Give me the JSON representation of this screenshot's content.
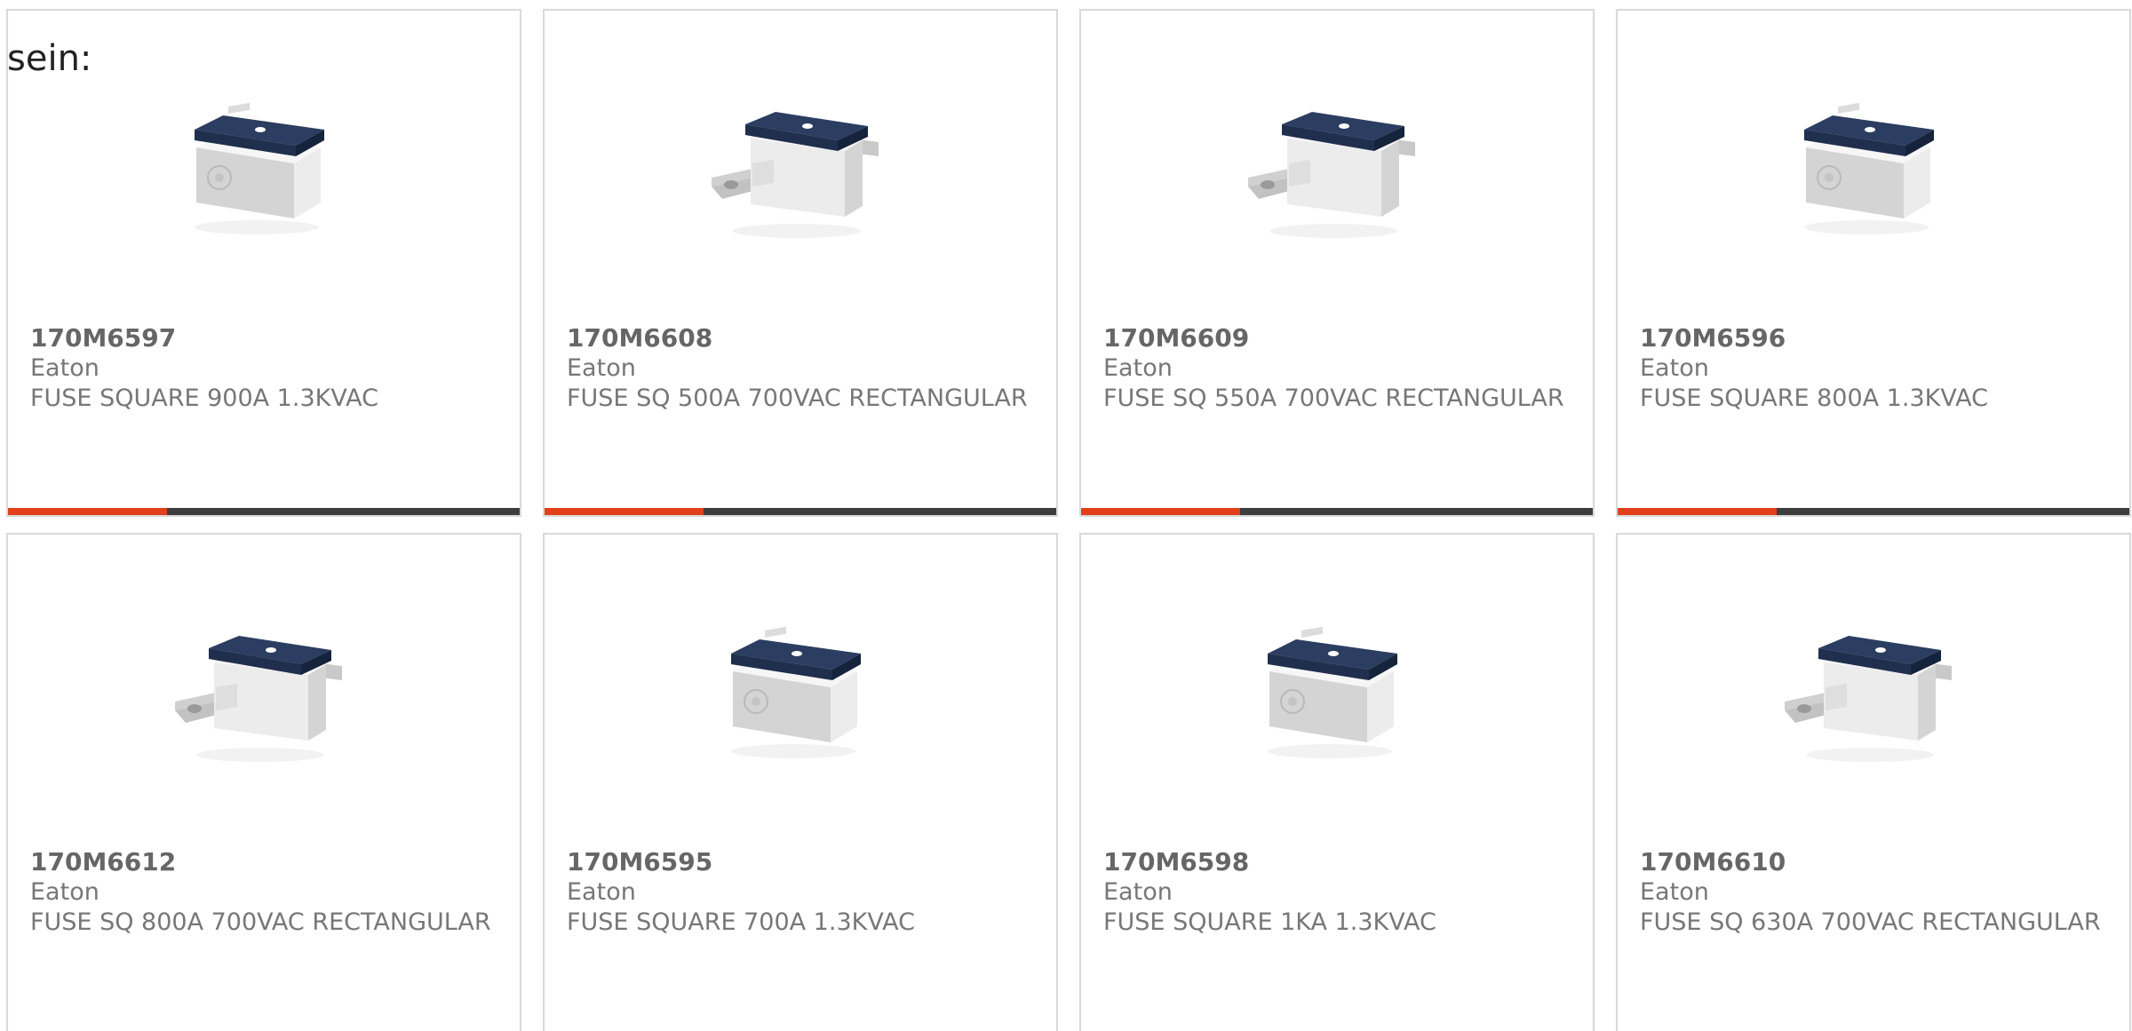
{
  "intro_text": "sein:",
  "colors": {
    "bar_track": "#3d3d3d",
    "bar_fill": "#e1401a",
    "card_border": "#d9d9d9"
  },
  "products": [
    {
      "mpn": "170M6597",
      "manufacturer": "Eaton",
      "description": "FUSE SQUARE 900A 1.3KVAC",
      "image": "fuse-square-body-image",
      "bar_fill_fraction": 0.31
    },
    {
      "mpn": "170M6608",
      "manufacturer": "Eaton",
      "description": "FUSE SQ 500A 700VAC RECTANGULAR",
      "image": "fuse-with-tabs-image",
      "bar_fill_fraction": 0.31
    },
    {
      "mpn": "170M6609",
      "manufacturer": "Eaton",
      "description": "FUSE SQ 550A 700VAC RECTANGULAR",
      "image": "fuse-with-tabs-image",
      "bar_fill_fraction": 0.31
    },
    {
      "mpn": "170M6596",
      "manufacturer": "Eaton",
      "description": "FUSE SQUARE 800A 1.3KVAC",
      "image": "fuse-square-body-image",
      "bar_fill_fraction": 0.31
    },
    {
      "mpn": "170M6612",
      "manufacturer": "Eaton",
      "description": "FUSE SQ 800A 700VAC RECTANGULAR",
      "image": "fuse-with-tabs-image"
    },
    {
      "mpn": "170M6595",
      "manufacturer": "Eaton",
      "description": "FUSE SQUARE 700A 1.3KVAC",
      "image": "fuse-square-body-image"
    },
    {
      "mpn": "170M6598",
      "manufacturer": "Eaton",
      "description": "FUSE SQUARE 1KA 1.3KVAC",
      "image": "fuse-square-body-image"
    },
    {
      "mpn": "170M6610",
      "manufacturer": "Eaton",
      "description": "FUSE SQ 630A 700VAC RECTANGULAR",
      "image": "fuse-with-tabs-image"
    }
  ]
}
